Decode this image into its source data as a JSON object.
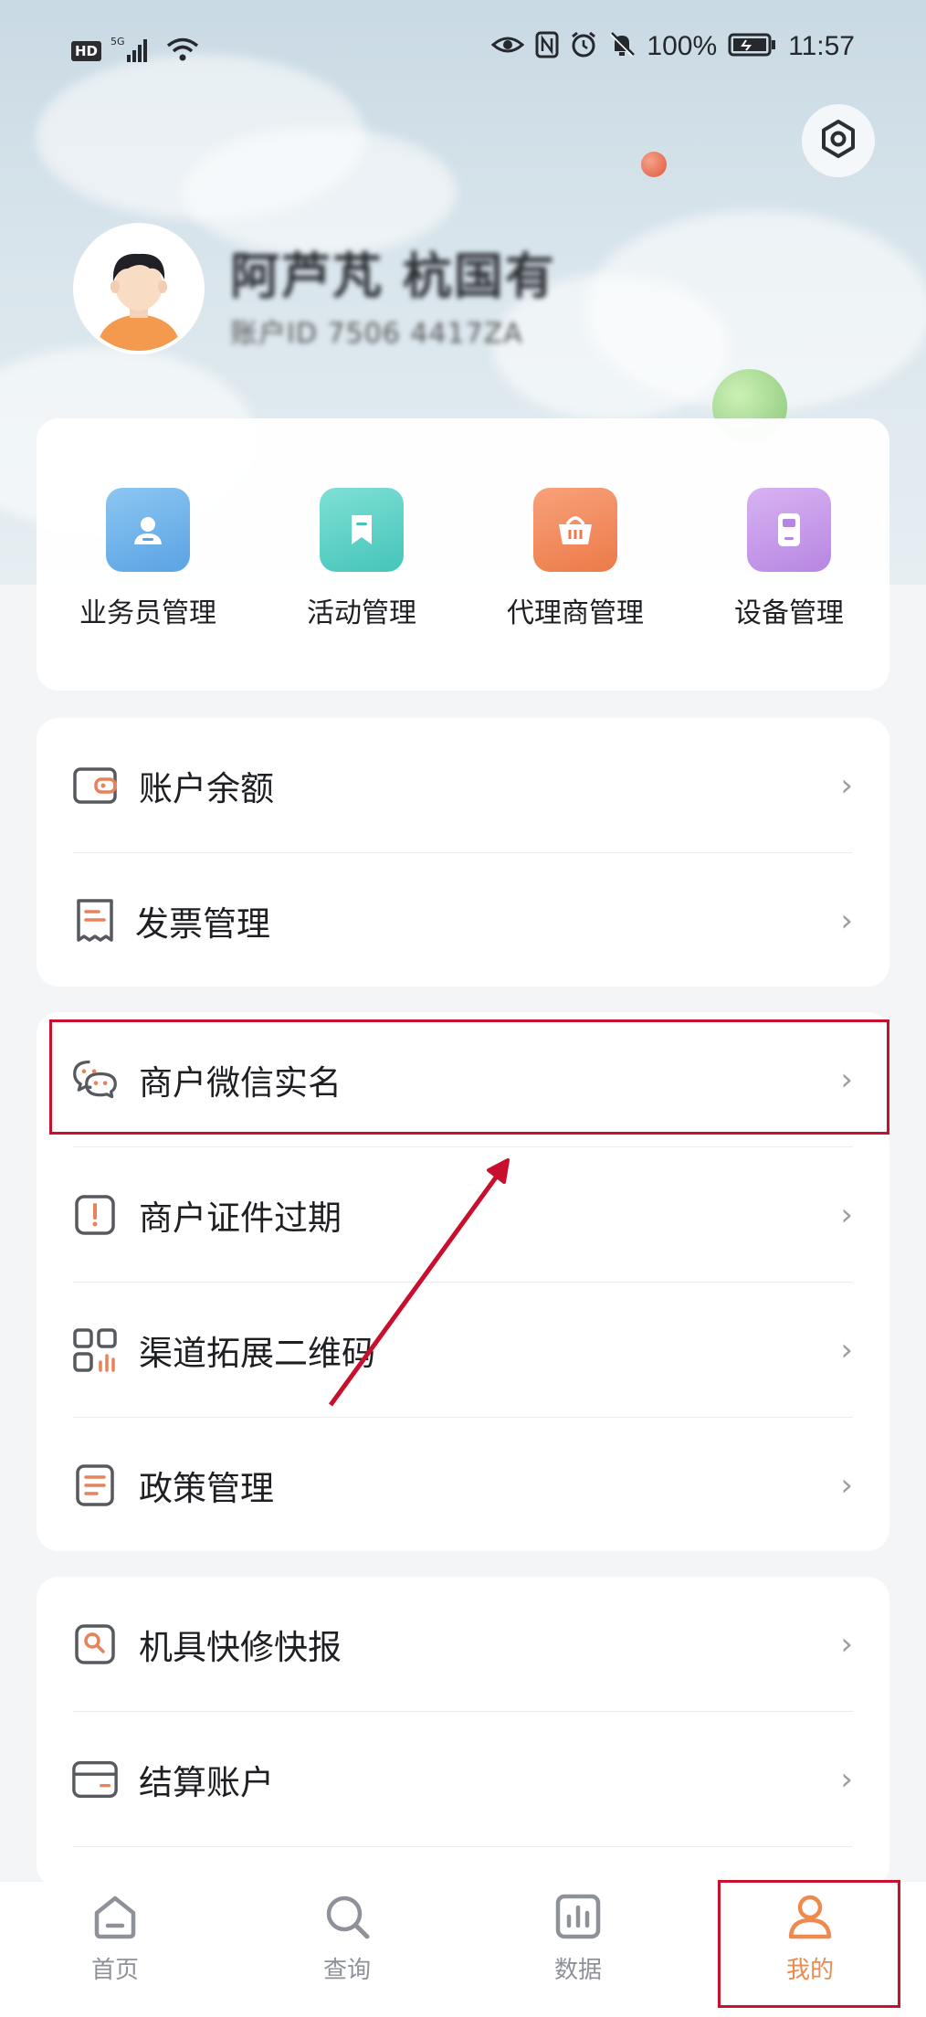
{
  "status_bar": {
    "hd": "HD",
    "signal": "5G",
    "battery": "100%",
    "time": "11:57"
  },
  "profile": {
    "name": "阿芦芃 杭国有",
    "account_id": "账户ID 7506 4417ZA"
  },
  "quick_actions": [
    {
      "label": "业务员管理",
      "icon": "person-card-icon",
      "color": "#6fb3ea"
    },
    {
      "label": "活动管理",
      "icon": "bookmark-icon",
      "color": "#5fd2c7"
    },
    {
      "label": "代理商管理",
      "icon": "basket-icon",
      "color": "#f08a5b"
    },
    {
      "label": "设备管理",
      "icon": "device-icon",
      "color": "#c79be8"
    }
  ],
  "menu_group_1": [
    {
      "label": "账户余额",
      "chevron": "›"
    },
    {
      "label": "发票管理",
      "chevron": "›"
    }
  ],
  "menu_group_2": [
    {
      "label": "商户微信实名",
      "chevron": "›"
    },
    {
      "label": "商户证件过期",
      "chevron": "›"
    },
    {
      "label": "渠道拓展二维码",
      "chevron": "›"
    },
    {
      "label": "政策管理",
      "chevron": "›"
    }
  ],
  "menu_group_3": [
    {
      "label": "机具快修快报",
      "chevron": "›"
    },
    {
      "label": "结算账户",
      "chevron": "›"
    }
  ],
  "tabs": [
    {
      "label": "首页",
      "icon": "home-icon"
    },
    {
      "label": "查询",
      "icon": "search-icon"
    },
    {
      "label": "数据",
      "icon": "chart-icon"
    },
    {
      "label": "我的",
      "icon": "user-icon",
      "active": true
    }
  ],
  "colors": {
    "accent": "#ee8a4e",
    "highlight": "#c8102e",
    "icon_orange": "#e9825a"
  }
}
